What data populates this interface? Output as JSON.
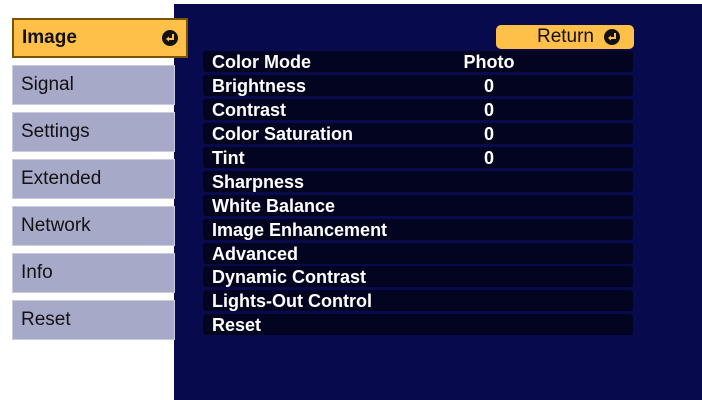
{
  "menu": {
    "tabs": [
      {
        "label": "Image"
      },
      {
        "label": "Signal"
      },
      {
        "label": "Settings"
      },
      {
        "label": "Extended"
      },
      {
        "label": "Network"
      },
      {
        "label": "Info"
      },
      {
        "label": "Reset"
      }
    ],
    "active_tab": "Image"
  },
  "return_button": {
    "label": "Return"
  },
  "settings": [
    {
      "label": "Color Mode",
      "value": "Photo"
    },
    {
      "label": "Brightness",
      "value": "0"
    },
    {
      "label": "Contrast",
      "value": "0"
    },
    {
      "label": "Color Saturation",
      "value": "0"
    },
    {
      "label": "Tint",
      "value": "0"
    },
    {
      "label": "Sharpness",
      "value": ""
    },
    {
      "label": "White Balance",
      "value": ""
    },
    {
      "label": "Image Enhancement",
      "value": ""
    },
    {
      "label": "Advanced",
      "value": ""
    },
    {
      "label": "Dynamic Contrast",
      "value": ""
    },
    {
      "label": "Lights-Out Control",
      "value": ""
    },
    {
      "label": "Reset",
      "value": ""
    }
  ],
  "colors": {
    "accent": "#ffc04a",
    "panel": "#080a4e",
    "tab": "#a6a9c8"
  },
  "icons": {
    "enter": "enter-arrow-icon"
  }
}
